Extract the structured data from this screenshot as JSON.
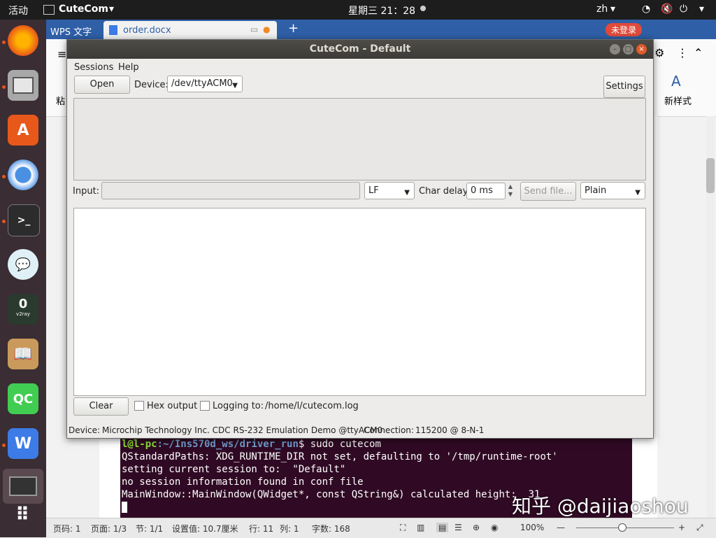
{
  "topbar": {
    "activities": "活动",
    "app_name": "CuteCom",
    "clock": "星期三 21：28",
    "lang": "zh"
  },
  "dock": {
    "items": [
      "firefox-icon",
      "files-icon",
      "software-icon",
      "chromium-icon",
      "terminal-icon",
      "wechat-icon",
      "v2ray-icon",
      "reader-icon",
      "qt-creator-icon",
      "wps-icon",
      "screen-icon",
      "apps-grid-icon"
    ],
    "v2ray_label": "v2ray",
    "qt_label": "QC",
    "wps_label": "W"
  },
  "wps": {
    "app_tab": "WPS 文字",
    "doc_tab": "order.docx",
    "add_tab": "+",
    "login_button": "未登录",
    "ribbon_paste": "粘",
    "ribbon_style": "新样式",
    "status": {
      "page_num": "页码: 1",
      "page": "页面: 1/3",
      "section": "节: 1/1",
      "setting": "设置值: 10.7厘米",
      "row": "行: 11",
      "col": "列: 1",
      "words": "字数: 168",
      "zoom": "100%"
    }
  },
  "terminal": {
    "prompt_user": "l@l-pc",
    "prompt_path": ":~/Ins570d_ws/driver_run",
    "command": "$ sudo cutecom",
    "lines": [
      "QStandardPaths: XDG_RUNTIME_DIR not set, defaulting to '/tmp/runtime-root'",
      "setting current session to:  \"Default\"",
      "no session information found in conf file",
      "MainWindow::MainWindow(QWidget*, const QString&) calculated height:  31"
    ]
  },
  "watermark": "知乎 @daijiaoshou",
  "cutecom": {
    "title": "CuteCom - Default",
    "menu": [
      "Sessions",
      "Help"
    ],
    "open_button": "Open",
    "device_label": "Device:",
    "device_value": "/dev/ttyACM0",
    "settings_button": "Settings",
    "input_label": "Input:",
    "line_ending": "LF",
    "char_delay_label": "Char delay:",
    "char_delay_value": "0 ms",
    "send_file_button": "Send file...",
    "format": "Plain",
    "clear_button": "Clear",
    "hex_output_label": "Hex output",
    "logging_label": "Logging to:",
    "log_path": "/home/l/cutecom.log",
    "status_device_label": "Device:",
    "status_device": "Microchip Technology Inc. CDC RS-232 Emulation Demo @ttyACM0",
    "status_connection_label": "Connection:",
    "status_connection": "115200 @ 8-N-1"
  }
}
